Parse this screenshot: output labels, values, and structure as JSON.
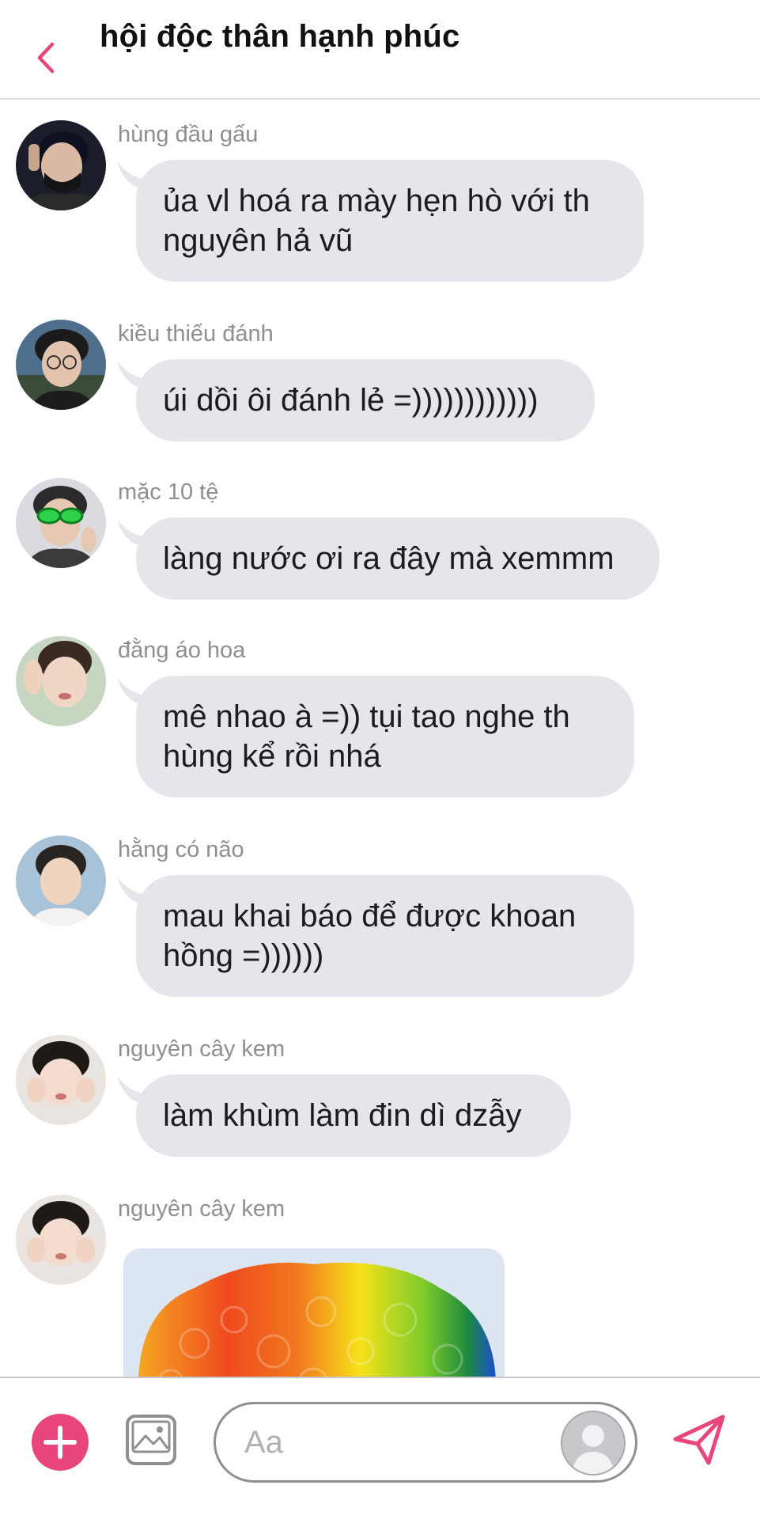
{
  "header": {
    "title": "hội độc thân hạnh phúc",
    "accent_color": "#e8457a"
  },
  "messages": [
    {
      "sender": "hùng đầu gấu",
      "lines": [
        "ủa vl hoá ra mày hẹn hò với th",
        "nguyên hả vũ"
      ],
      "avatar_icon": "avatar-masked-face"
    },
    {
      "sender": "kiều thiếu đánh",
      "lines": [
        "úi dồi ôi đánh lẻ =))))))))))))"
      ],
      "avatar_icon": "avatar-glasses-face"
    },
    {
      "sender": "mặc 10 tệ",
      "lines": [
        "làng nước ơi ra đây mà xemmm"
      ],
      "avatar_icon": "avatar-green-glasses-face"
    },
    {
      "sender": "đằng áo hoa",
      "lines": [
        "mê nhao à =)) tụi tao nghe th",
        "hùng kể rồi nhá"
      ],
      "avatar_icon": "avatar-waving-face"
    },
    {
      "sender": "hằng có não",
      "lines": [
        "mau khai báo để được khoan",
        "hồng =))))))"
      ],
      "avatar_icon": "avatar-face"
    },
    {
      "sender": "nguyên cây kem",
      "lines": [
        "làm khùm làm đin dì dzẫy"
      ],
      "avatar_icon": "avatar-cheeks-face"
    },
    {
      "sender": "nguyên cây kem",
      "image": "rainbow-clown-wig-image",
      "avatar_icon": "avatar-cheeks-face"
    }
  ],
  "composer": {
    "placeholder": "Aa",
    "plus_icon": "plus-icon",
    "gallery_icon": "gallery-icon",
    "send_icon": "send-icon",
    "profile_icon": "default-profile-icon"
  },
  "colors": {
    "bubble": "#e5e6eb",
    "accent": "#e8457a",
    "sender_name": "#8e8e93"
  }
}
